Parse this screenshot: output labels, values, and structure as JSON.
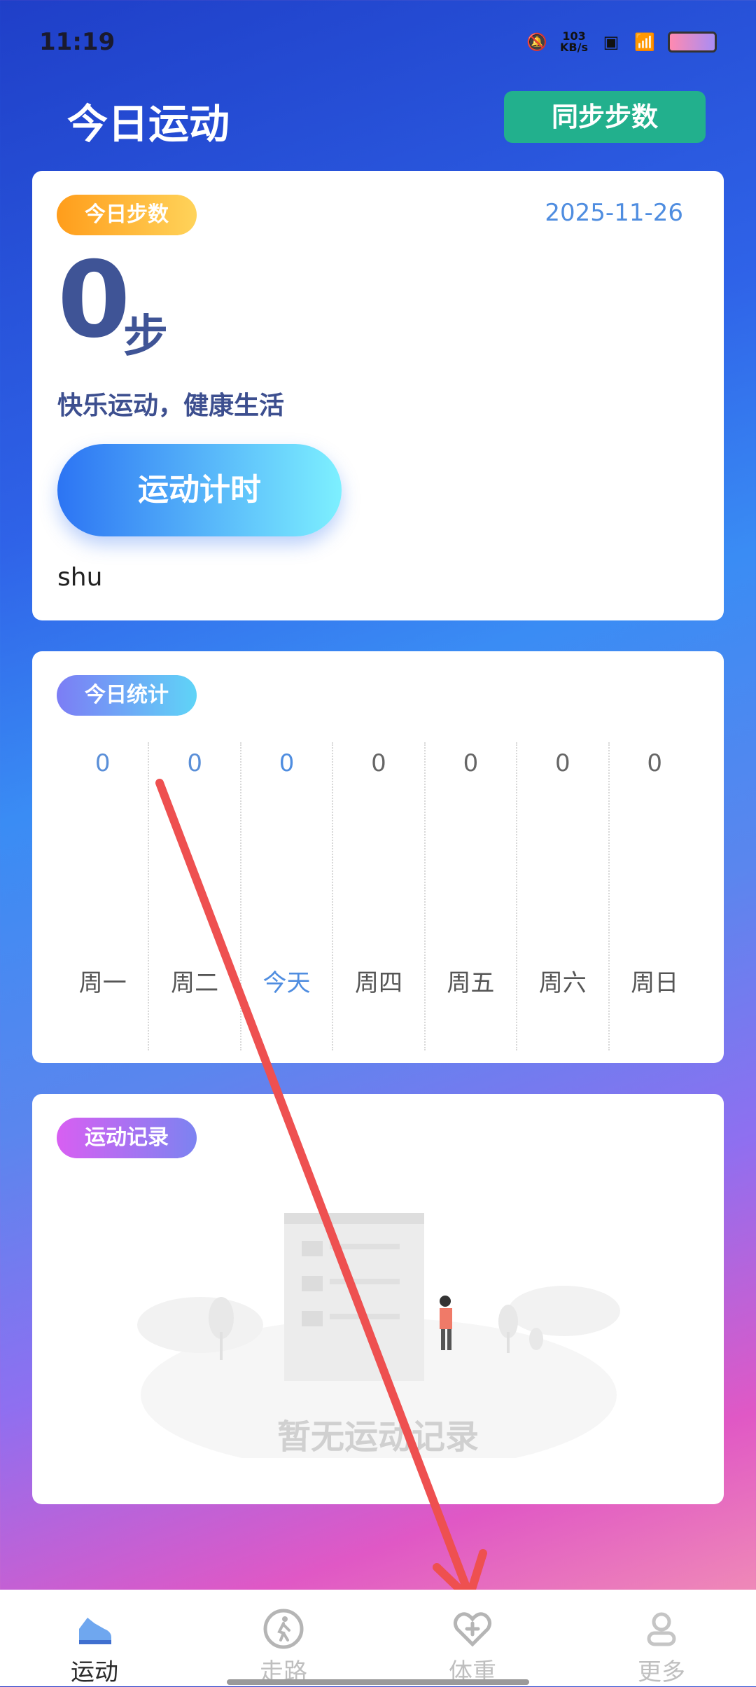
{
  "status_bar": {
    "time": "11:19",
    "net_speed_value": "103",
    "net_speed_unit": "KB/s"
  },
  "header": {
    "title": "今日运动",
    "sync_button": "同步步数"
  },
  "today_steps": {
    "tag": "今日步数",
    "date": "2025-11-26",
    "count": "0",
    "unit": "步",
    "slogan": "快乐运动，健康生活",
    "timer_button": "运动计时",
    "user": "shu"
  },
  "today_stats": {
    "tag": "今日统计",
    "days": [
      {
        "label": "周一",
        "value": "0"
      },
      {
        "label": "周二",
        "value": "0"
      },
      {
        "label": "今天",
        "value": "0"
      },
      {
        "label": "周四",
        "value": "0"
      },
      {
        "label": "周五",
        "value": "0"
      },
      {
        "label": "周六",
        "value": "0"
      },
      {
        "label": "周日",
        "value": "0"
      }
    ]
  },
  "records": {
    "tag": "运动记录",
    "empty_text": "暂无运动记录"
  },
  "tabbar": {
    "tabs": [
      {
        "label": "运动",
        "icon": "shoe-icon"
      },
      {
        "label": "走路",
        "icon": "walking-icon"
      },
      {
        "label": "体重",
        "icon": "heart-plus-icon"
      },
      {
        "label": "更多",
        "icon": "person-icon"
      }
    ]
  },
  "colors": {
    "accent": "#4f8de0",
    "sync": "#22b08d",
    "annotation_arrow": "#ee5050"
  }
}
